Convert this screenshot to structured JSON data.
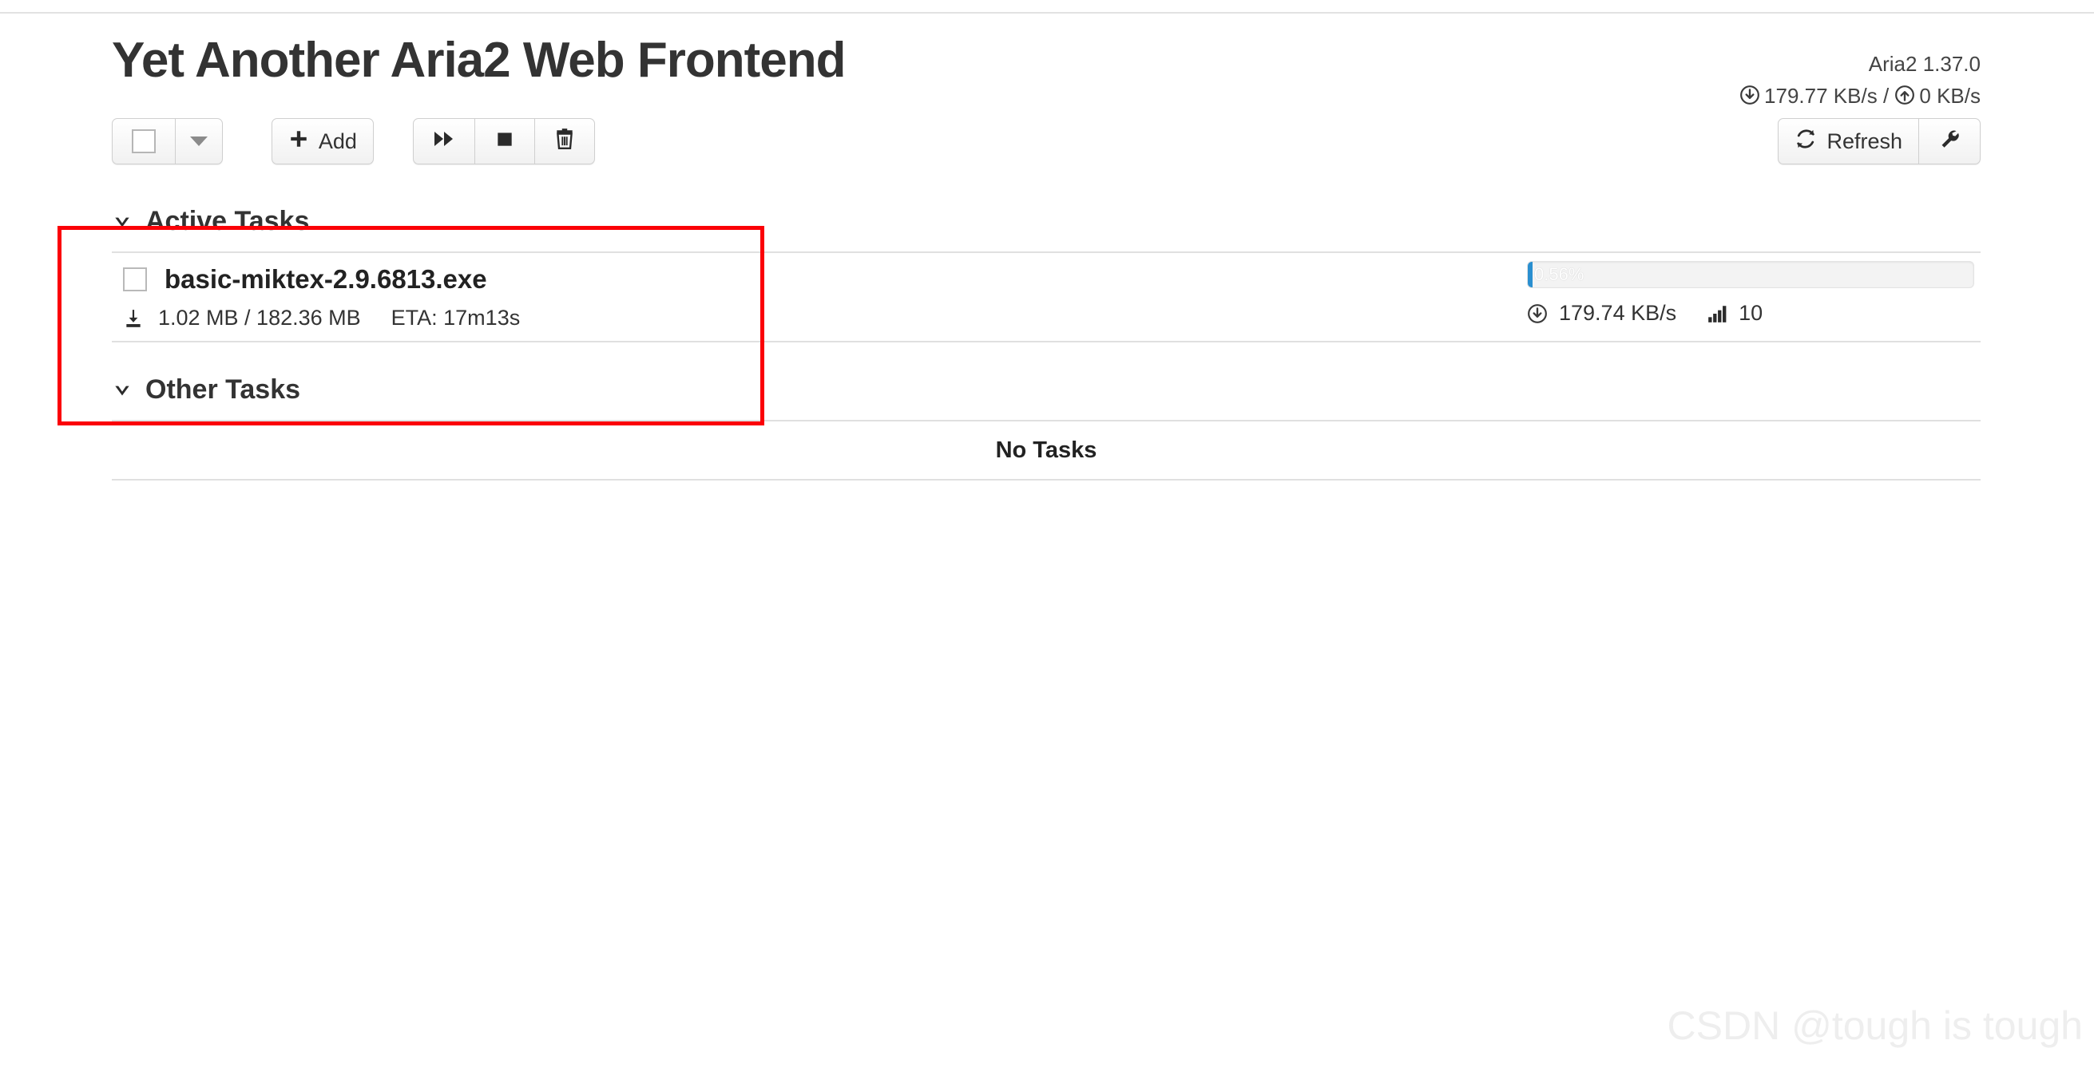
{
  "header": {
    "app_title": "Yet Another Aria2 Web Frontend",
    "aria2_version": "Aria2 1.37.0",
    "global_download_speed": "179.77 KB/s",
    "global_speed_separator": "/",
    "global_upload_speed": "0 KB/s",
    "download_icon": "download-circle-icon",
    "upload_icon": "upload-circle-icon"
  },
  "toolbar": {
    "select_all_checkbox": "",
    "select_dropdown_icon": "caret-down-icon",
    "add_label": "Add",
    "add_icon": "plus-icon",
    "resume_icon": "fast-forward-icon",
    "stop_icon": "stop-square-icon",
    "delete_icon": "trash-icon",
    "refresh_label": "Refresh",
    "refresh_icon": "refresh-icon",
    "settings_icon": "wrench-icon"
  },
  "active_section": {
    "title": "Active Tasks",
    "collapse_icon": "chevron-down-icon",
    "tasks": [
      {
        "name": "basic-miktex-2.9.6813.exe",
        "type_icon": "download-tray-icon",
        "downloaded": "1.02 MB",
        "size_separator": "/",
        "total_size": "182.36 MB",
        "size_text": "1.02 MB / 182.36 MB",
        "eta": "ETA: 17m13s",
        "progress_percent": "0.56%",
        "progress_value": 0.56,
        "speed": "179.74 KB/s",
        "speed_icon": "download-circle-icon",
        "connections": "10",
        "connections_icon": "signal-bars-icon",
        "checkbox": ""
      }
    ]
  },
  "other_section": {
    "title": "Other Tasks",
    "collapse_icon": "chevron-down-icon",
    "empty_text": "No Tasks"
  },
  "annotation": {
    "color": "#fb0007"
  },
  "watermark": {
    "text": "CSDN @tough is tough"
  }
}
